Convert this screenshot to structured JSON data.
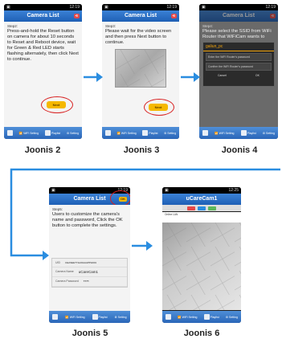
{
  "common": {
    "camera_list_title": "Camera List",
    "ucarecam_title": "uCareCam1",
    "bottom_items": [
      "WiFi Setting",
      "Playlist",
      "Setting"
    ]
  },
  "panel2": {
    "step": "Step2:",
    "text": "Press-and-hold the Reset button on camera for about 10 seconds to Reset and Reboot device, wait for Green & Red LED starts flashing alternately, then click Next to continue.",
    "next": "Next",
    "caption": "Joonis 2"
  },
  "panel3": {
    "step": "Step3:",
    "text": "Please wait for the video screen and then press Next button to continue.",
    "next": "Next",
    "caption": "Joonis 3"
  },
  "panel4": {
    "step": "Step4:",
    "text": "Please select the SSID from WiFi Router that WiFiCam wants to",
    "dialog_title": "galiun_pc",
    "enter_password": "Enter the WiFi Router's password",
    "confirm_password": "Confirm the WiFi Router's password",
    "cancel": "Cancel",
    "ok": "OK",
    "caption": "Joonis 4"
  },
  "panel5": {
    "step": "Step5:",
    "text": "Users to customize the camera's name and password, Click the OK button to complete the settings.",
    "ok_tag": "OK",
    "uid_label": "UID",
    "uid_value": "CEASEETYHA6AAAPPH001",
    "name_label": "Camera Name",
    "name_value": "uCareCam1",
    "pwd_label": "Camera Password",
    "pwd_value": "****",
    "caption": "Joonis 5"
  },
  "panel6": {
    "status_line": "Online  LAN",
    "caption": "Joonis 6"
  },
  "colors": {
    "accent_blue": "#2a8de0",
    "highlight_red": "#d81f1f",
    "next_yellow": "#f5b800"
  }
}
